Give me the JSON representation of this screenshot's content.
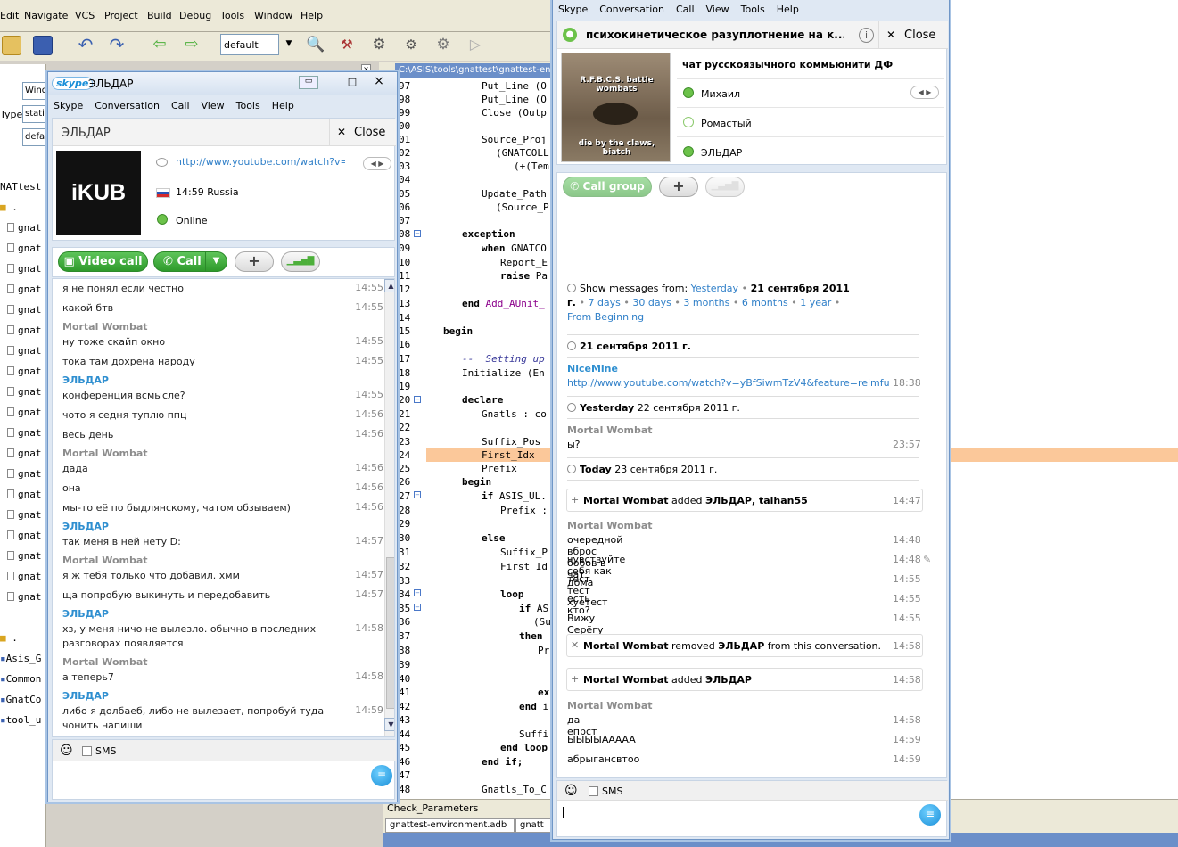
{
  "ide": {
    "menu": [
      "Edit",
      "Navigate",
      "VCS",
      "Project",
      "Build",
      "Debug",
      "Tools",
      "Window",
      "Help"
    ],
    "config_value": "default",
    "left_labels": {
      "type": "Type"
    },
    "left_fields": [
      "Windo",
      "static",
      "defa"
    ],
    "tree_items": [
      "NATtest",
      ".",
      "gnat",
      "gnat",
      "gnat",
      "gnat",
      "gnat",
      "gnat",
      "gnat",
      "gnat",
      "gnat",
      "gnat",
      "gnat",
      "gnat",
      "gnat",
      "gnat",
      "gnat",
      "gnat",
      "gnat",
      "gnat",
      "gnat",
      ".",
      "Asis_G",
      "Common",
      "GnatCo",
      "tool_u"
    ],
    "editor_tab": "C:\\ASIS\\tools\\gnattest\\gnattest-env",
    "line_numbers": [
      "97",
      "98",
      "99",
      "00",
      "01",
      "02",
      "03",
      "04",
      "05",
      "06",
      "07",
      "08",
      "09",
      "10",
      "11",
      "12",
      "13",
      "14",
      "15",
      "16",
      "17",
      "18",
      "19",
      "20",
      "21",
      "22",
      "23",
      "24",
      "25",
      "26",
      "27",
      "28",
      "29",
      "30",
      "31",
      "32",
      "33",
      "34",
      "35",
      "36",
      "37",
      "38",
      "39",
      "40",
      "41",
      "42",
      "43",
      "44",
      "45",
      "46",
      "47",
      "48"
    ],
    "code": {
      "l1": "Put_Line (O",
      "l2": "Put_Line (O",
      "l3": "Close (Outp",
      "l4": "Source_Proj",
      "l5": "(GNATCOLL",
      "l6": "(+(Tem",
      "l7": "Update_Path",
      "l8": "(Source_P",
      "exception": "exception",
      "when": "when",
      "when_rest": " GNATCO",
      "report": "Report_E",
      "raise": "raise",
      "raise_rest": " Pa",
      "end": "end",
      "end_rest": "Add_AUnit_",
      "begin": "begin",
      "comment": "--  Setting up",
      "init": "Initialize (En",
      "declare": "declare",
      "gnatls": "Gnatls : co",
      "suffix": "Suffix_Pos",
      "first": "First_Idx",
      "prefix": "Prefix",
      "begin2": "begin",
      "if": "if",
      "if_rest": " ASIS_UL.",
      "prefix2": "Prefix :",
      "else": "else",
      "suffix_p": "Suffix_P",
      "first_id": "First_Id",
      "loop": "loop",
      "if2": "if",
      "if2_rest": " AS",
      "su": "(Su",
      "then": "then",
      "pr": "Pr",
      "ex": "ex",
      "end_i": "end",
      "end_i_rest": " i",
      "suffi": "Suffi",
      "end_loop": "end loop",
      "end_if": "end if;",
      "gnatls_to": "Gnatls_To_C"
    },
    "bottom_title": "Check_Parameters",
    "bottom_tabs": [
      "gnattest-environment.adb",
      "gnatt"
    ]
  },
  "skype1": {
    "logo": "skype",
    "title": "ЭЛЬДАР",
    "menu": [
      "Skype",
      "Conversation",
      "Call",
      "View",
      "Tools",
      "Help"
    ],
    "header_name": "ЭЛЬДАР",
    "close_label": "Close",
    "avatar_text": "iKUB",
    "mood_link": "http://www.youtube.com/watch?v=...",
    "local_time": "14:59 Russia",
    "status": "Online",
    "video_call": "Video call",
    "call": "Call",
    "messages": [
      {
        "text": "я не понял если честно",
        "time": "14:55"
      },
      {
        "text": "какой бтв",
        "time": "14:55"
      },
      {
        "sender": "Mortal Wombat"
      },
      {
        "text": "ну тоже скайп окно",
        "time": "14:55"
      },
      {
        "text": "тока там дохрена народу",
        "time": "14:55"
      },
      {
        "sender_b": "ЭЛЬДАР"
      },
      {
        "text": "конференция всмысле?",
        "time": "14:55"
      },
      {
        "text": "чото я седня туплю ппц",
        "time": "14:56"
      },
      {
        "text": "весь день",
        "time": "14:56"
      },
      {
        "sender": "Mortal Wombat"
      },
      {
        "text": "дада",
        "time": "14:56"
      },
      {
        "text": "она",
        "time": "14:56"
      },
      {
        "text": "мы-то её по быдлянскому, чатом обзываем)",
        "time": "14:56"
      },
      {
        "sender_b": "ЭЛЬДАР"
      },
      {
        "text": "так меня в ней нету D:",
        "time": "14:57"
      },
      {
        "sender": "Mortal Wombat"
      },
      {
        "text": "я ж тебя только что добавил. хмм",
        "time": "14:57"
      },
      {
        "text": "ща попробую выкинуть и передобавить",
        "time": "14:57"
      },
      {
        "sender_b": "ЭЛЬДАР"
      },
      {
        "text": "хз, у меня ничо не вылезло. обычно в последних разговорах появляется",
        "time": "14:58"
      },
      {
        "sender": "Mortal Wombat"
      },
      {
        "text": "а теперь7",
        "time": "14:58"
      },
      {
        "sender_b": "ЭЛЬДАР"
      },
      {
        "text": "либо я долбаеб, либо не вылезает, попробуй туда чонить напиши",
        "time": "14:59"
      }
    ],
    "sms_label": "SMS"
  },
  "skype2": {
    "menu": [
      "Skype",
      "Conversation",
      "Call",
      "View",
      "Tools",
      "Help"
    ],
    "title": "психокинетическое разуплотнение на к...",
    "close_label": "Close",
    "topic": "чат русскоязычного коммьюнити ДФ",
    "image_caption_top": "R.F.B.C.S. battle wombats",
    "image_caption_bottom": "die by the claws, biatch",
    "participants": [
      "Михаил",
      "Ромастый",
      "ЭЛЬДАР"
    ],
    "call_group": "Call group",
    "show_messages": {
      "prefix": "Show messages from:",
      "yesterday": "Yesterday",
      "date": "21 сентября 2011 г.",
      "seven": "7",
      "days": "days",
      "thirty": "30 days",
      "three_months": "3 months",
      "six_months": "6 months",
      "year": "1 year",
      "from": "From",
      "beginning": "Beginning"
    },
    "date1": "21 сентября 2011 г.",
    "nicemine": "NiceMine",
    "nicemine_link": "http://www.youtube.com/watch?v=yBfSiwmTzV4&feature=relmfu",
    "nicemine_time": "18:38",
    "yesterday_label": "Yesterday",
    "yesterday_date": "22 сентября 2011 г.",
    "mw_sender": "Mortal Wombat",
    "mw_msg": "ы?",
    "mw_time": "23:57",
    "today_label": "Today",
    "today_date": "23 сентября 2011 г.",
    "event1": {
      "actor": "Mortal Wombat",
      "verb": "added",
      "target": "ЭЛЬДАР, taihan55",
      "time": "14:47"
    },
    "mw2": [
      {
        "text": "очередной вброс бобов в чат",
        "time": "14:48"
      },
      {
        "text": "чувствуйте себя как дома",
        "time": "14:48"
      },
      {
        "text": "тест тест хуетест",
        "time": "14:55"
      },
      {
        "text": "есть кто?",
        "time": "14:55"
      },
      {
        "text": "Вижу Серёгу",
        "time": "14:55"
      }
    ],
    "event2": {
      "actor": "Mortal Wombat",
      "verb": "removed",
      "target": "ЭЛЬДАР",
      "rest": "from this conversation.",
      "time": "14:58"
    },
    "event3": {
      "actor": "Mortal Wombat",
      "verb": "added",
      "target": "ЭЛЬДАР",
      "time": "14:58"
    },
    "mw3": [
      {
        "text": "да ёпрст",
        "time": "14:58"
      },
      {
        "text": "ЫЫЫЫАААAA",
        "time": "14:59"
      },
      {
        "text": "абрыгансвтоо",
        "time": "14:59"
      }
    ],
    "sms_label": "SMS"
  }
}
